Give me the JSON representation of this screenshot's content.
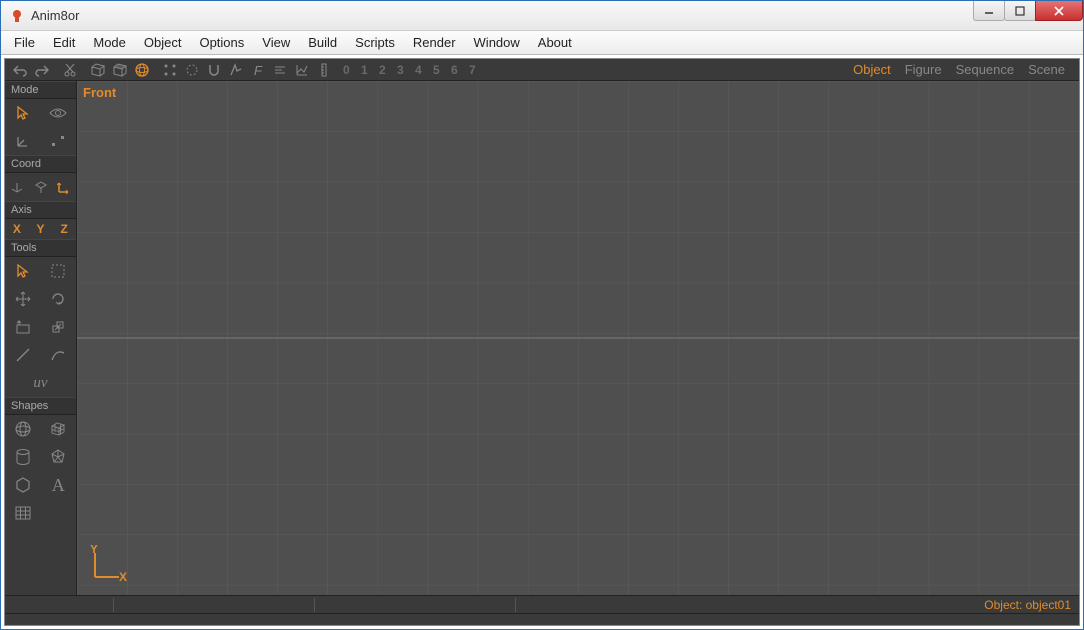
{
  "window": {
    "title": "Anim8or"
  },
  "menu": {
    "items": [
      "File",
      "Edit",
      "Mode",
      "Object",
      "Options",
      "View",
      "Build",
      "Scripts",
      "Render",
      "Window",
      "About"
    ]
  },
  "toolbar": {
    "layers": "0 1 2 3 4 5 6 7",
    "modeTabs": [
      "Object",
      "Figure",
      "Sequence",
      "Scene"
    ],
    "activeModeTab": "Object"
  },
  "toolbox": {
    "sections": {
      "mode": "Mode",
      "coord": "Coord",
      "axis": "Axis",
      "tools": "Tools",
      "shapes": "Shapes"
    },
    "axis": [
      "X",
      "Y",
      "Z"
    ],
    "uv": "uv"
  },
  "viewport": {
    "label": "Front",
    "axisY": "Y",
    "axisX": "X"
  },
  "status": {
    "right": "Object: object01"
  }
}
